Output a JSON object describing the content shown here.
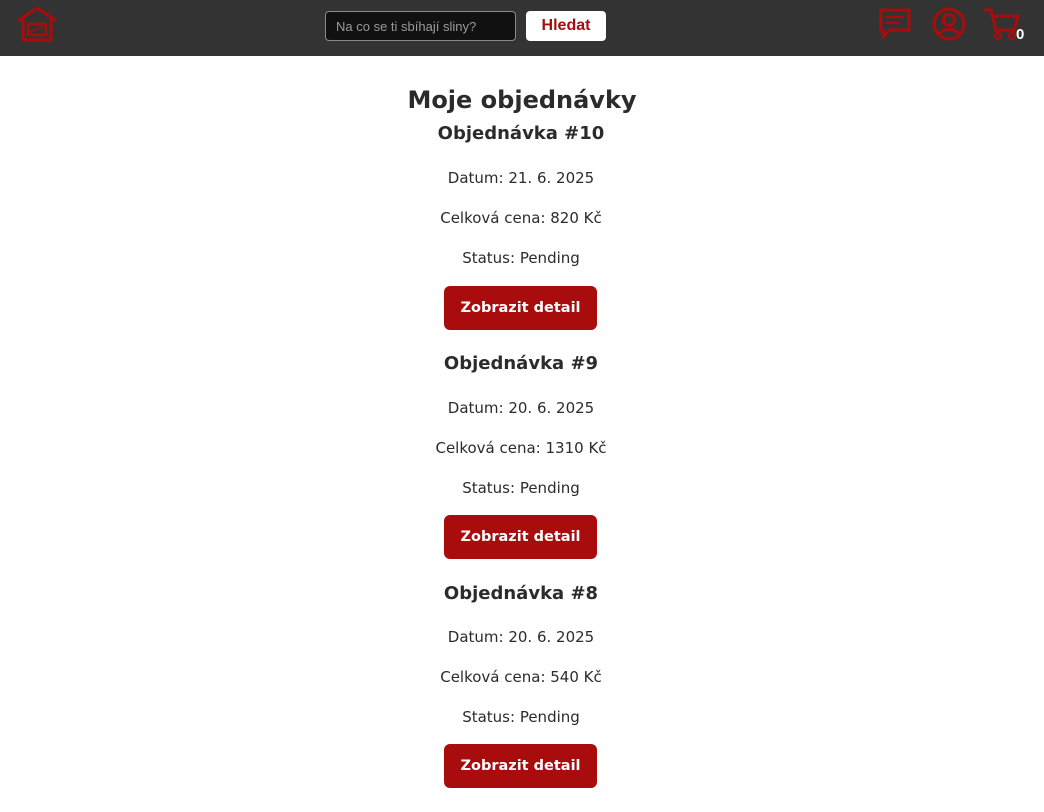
{
  "header": {
    "search_placeholder": "Na co se ti sbíhají sliny?",
    "search_value": "",
    "search_button_label": "Hledat",
    "cart_count": "0",
    "icons": {
      "logo": "house-logo-icon",
      "chat": "chat-icon",
      "account": "user-circle-icon",
      "cart": "cart-icon"
    }
  },
  "main": {
    "title": "Moje objednávky",
    "orders": [
      {
        "title": "Objednávka #10",
        "date": "Datum: 21. 6. 2025",
        "total": "Celková cena: 820 Kč",
        "status": "Status: Pending",
        "button_label": "Zobrazit detail"
      },
      {
        "title": "Objednávka #9",
        "date": "Datum: 20. 6. 2025",
        "total": "Celková cena: 1310 Kč",
        "status": "Status: Pending",
        "button_label": "Zobrazit detail"
      },
      {
        "title": "Objednávka #8",
        "date": "Datum: 20. 6. 2025",
        "total": "Celková cena: 540 Kč",
        "status": "Status: Pending",
        "button_label": "Zobrazit detail"
      }
    ]
  },
  "colors": {
    "header_bg": "#333333",
    "accent": "#a80c0c",
    "page_bg": "#ffffff",
    "text": "#2b2b2b"
  }
}
